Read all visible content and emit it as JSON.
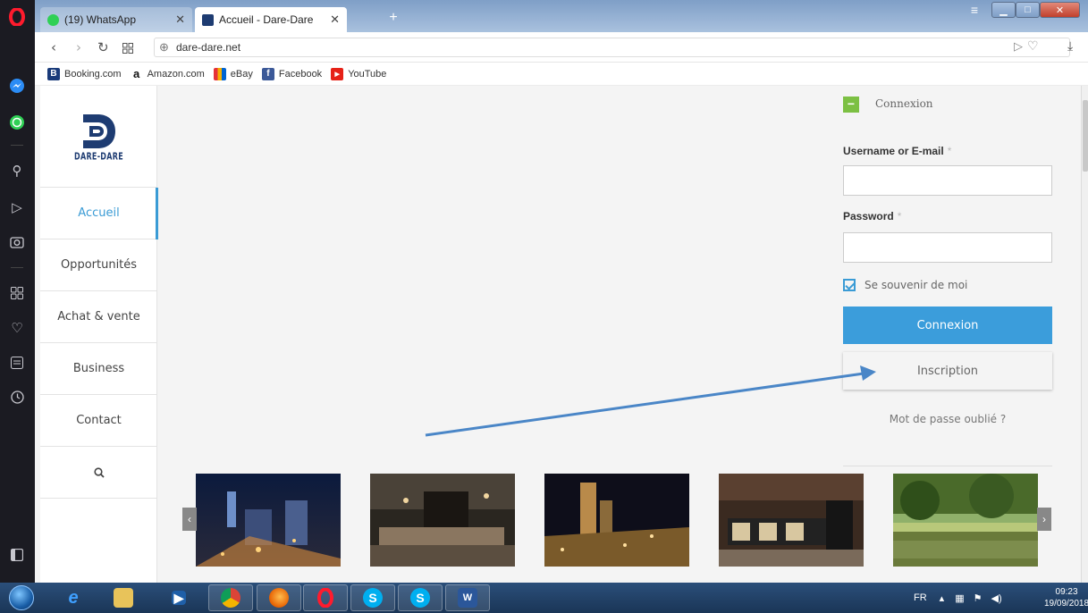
{
  "browser": {
    "tabs": [
      {
        "label": "(19) WhatsApp",
        "active": false
      },
      {
        "label": "Accueil - Dare-Dare",
        "active": true
      }
    ],
    "url": "dare-dare.net",
    "bookmarks": [
      {
        "label": "Booking.com",
        "icon": "booking-icon",
        "color": "#1a3b7a",
        "glyph": "B"
      },
      {
        "label": "Amazon.com",
        "icon": "amazon-icon",
        "color": "#111111",
        "glyph": "a"
      },
      {
        "label": "eBay",
        "icon": "ebay-icon",
        "color": "#e53238",
        "glyph": "e"
      },
      {
        "label": "Facebook",
        "icon": "facebook-icon",
        "color": "#3b5998",
        "glyph": "f"
      },
      {
        "label": "YouTube",
        "icon": "youtube-icon",
        "color": "#e62117",
        "glyph": "▶"
      }
    ]
  },
  "site": {
    "logo_text": "DARE-DARE",
    "nav": [
      {
        "label": "Accueil",
        "active": true
      },
      {
        "label": "Opportunités",
        "active": false
      },
      {
        "label": "Achat & vente",
        "active": false
      },
      {
        "label": "Business",
        "active": false
      },
      {
        "label": "Contact",
        "active": false
      }
    ],
    "accent_color": "#3a9bd5"
  },
  "login": {
    "toggle": "−",
    "title": "Connexion",
    "username_label": "Username or E-mail",
    "password_label": "Password",
    "required_mark": "*",
    "remember_label": "Se souvenir de moi",
    "remember_checked": true,
    "login_button": "Connexion",
    "register_button": "Inscription",
    "forgot_link": "Mot de passe oublié ?"
  },
  "gallery": {
    "items": [
      "city-night",
      "hotel-lounge",
      "skyline-night",
      "hotel-lobby",
      "park-lake"
    ]
  },
  "taskbar": {
    "language": "FR",
    "time": "09:23",
    "date": "19/09/2018"
  }
}
